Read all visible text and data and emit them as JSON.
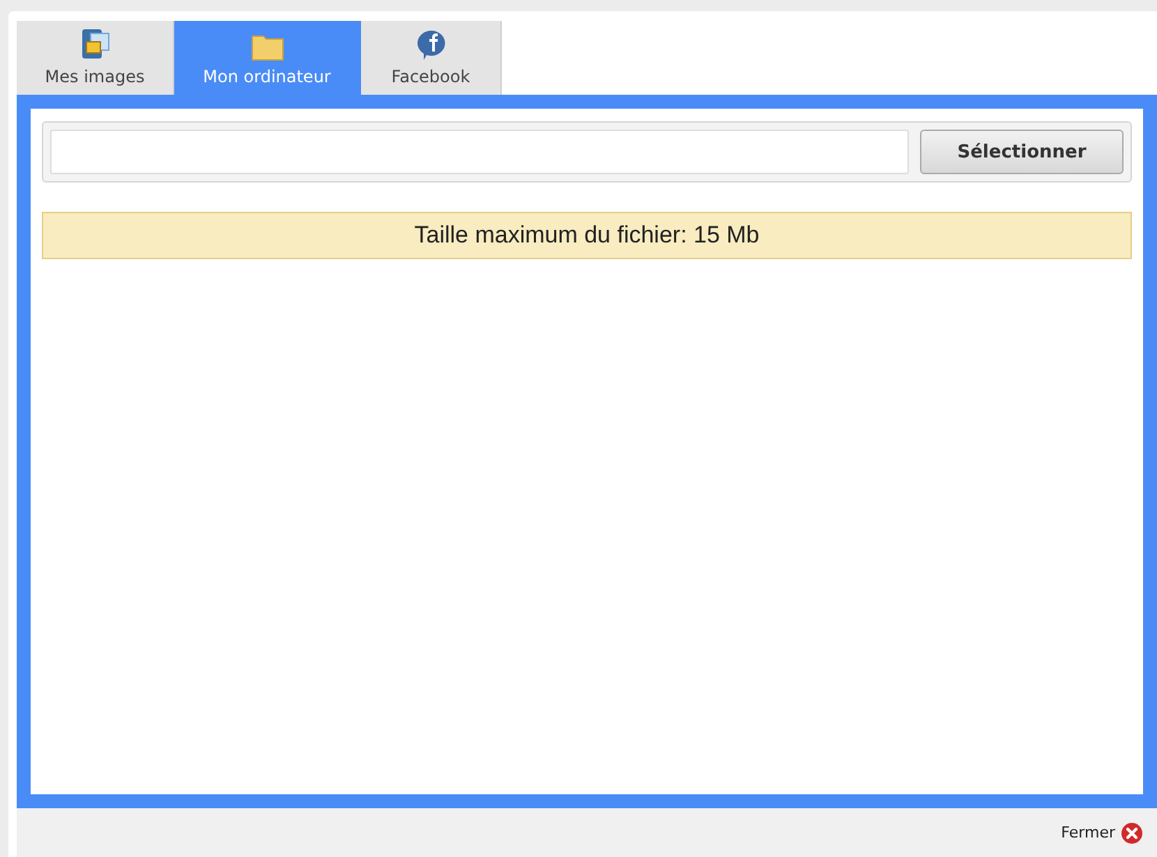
{
  "tabs": [
    {
      "label": "Mes images",
      "kind": "images",
      "selected": false
    },
    {
      "label": "Mon ordinateur",
      "kind": "folder",
      "selected": true
    },
    {
      "label": "Facebook",
      "kind": "bubble",
      "selected": false
    }
  ],
  "upload": {
    "button": "Sélectionner"
  },
  "notice": "Taille maximum du fichier: 15 Mb",
  "footer": {
    "close": "Fermer"
  }
}
